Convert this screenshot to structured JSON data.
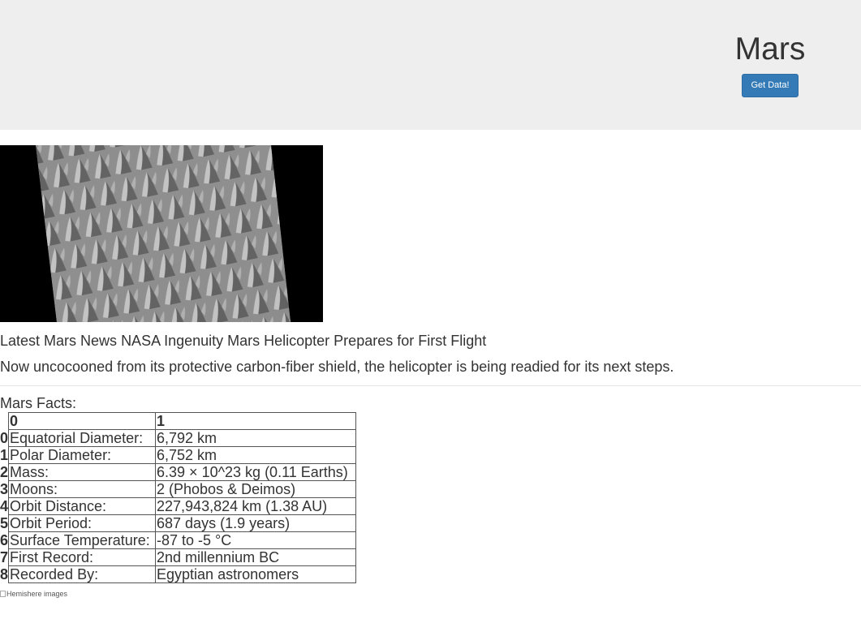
{
  "header": {
    "title": "Mars",
    "button_label": "Get Data!"
  },
  "featured_image": {
    "icon": "mars-surface-dunes-image"
  },
  "news": {
    "heading": "Latest Mars News",
    "title": "NASA Ingenuity Mars Helicopter Prepares for First Flight",
    "teaser": "Now uncocooned from its protective carbon-fiber shield, the helicopter is being readied for its next steps."
  },
  "facts": {
    "caption": "Mars Facts:",
    "columns": [
      "0",
      "1"
    ],
    "rows": [
      {
        "index": "0",
        "label": "Equatorial Diameter:",
        "value": "6,792 km"
      },
      {
        "index": "1",
        "label": "Polar Diameter:",
        "value": "6,752 km"
      },
      {
        "index": "2",
        "label": "Mass:",
        "value": "6.39 × 10^23 kg (0.11 Earths)"
      },
      {
        "index": "3",
        "label": "Moons:",
        "value": "2 (Phobos & Deimos)"
      },
      {
        "index": "4",
        "label": "Orbit Distance:",
        "value": "227,943,824 km (1.38 AU)"
      },
      {
        "index": "5",
        "label": "Orbit Period:",
        "value": "687 days (1.9 years)"
      },
      {
        "index": "6",
        "label": "Surface Temperature:",
        "value": "-87 to -5 °C"
      },
      {
        "index": "7",
        "label": "First Record:",
        "value": "2nd millennium BC"
      },
      {
        "index": "8",
        "label": "Recorded By:",
        "value": "Egyptian astronomers"
      }
    ]
  },
  "hemispheres": {
    "alt_text": "Hemishere images",
    "icon": "broken-image-icon"
  },
  "colors": {
    "jumbotron_bg": "#eeeeee",
    "button_bg": "#337ab7",
    "text": "#333333"
  }
}
